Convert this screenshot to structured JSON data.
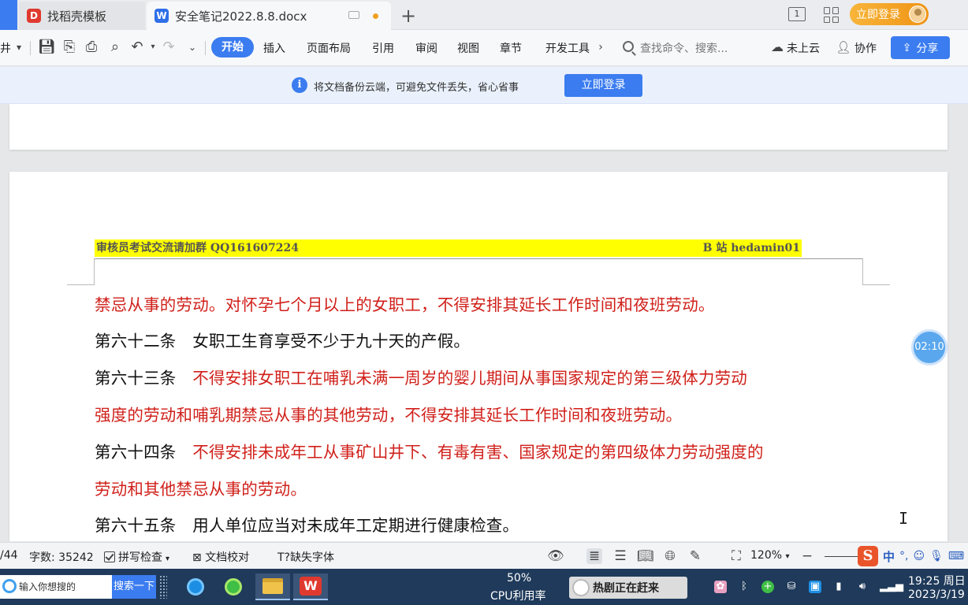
{
  "tabs": [
    {
      "label": "找稻壳模板",
      "icon": "docer-icon"
    },
    {
      "label": "安全笔记2022.8.8.docx",
      "icon": "wps-writer-icon"
    }
  ],
  "titlebar": {
    "page_indicator": "1",
    "login_label": "立即登录"
  },
  "toolbar": {
    "left_stub": "井",
    "ribbon_tabs": [
      "开始",
      "插入",
      "页面布局",
      "引用",
      "审阅",
      "视图",
      "章节",
      "开发工具"
    ],
    "search_placeholder": "查找命令、搜索...",
    "cloud_label": "未上云",
    "collab_label": "协作",
    "share_label": "分享"
  },
  "notice": {
    "text": "将文档备份云端，可避免文件丢失，省心省事",
    "button": "立即登录"
  },
  "document": {
    "header_left": "审核员考试交流请加群 QQ161607224",
    "header_right": "B 站 hedamin01",
    "lines": [
      {
        "segments": [
          {
            "text": "禁忌从事的劳动。对怀孕七个月以上的女职工，不得安排其延长工作时间和夜班劳动。",
            "color": "red"
          }
        ]
      },
      {
        "segments": [
          {
            "text": "第六十二条　女职工生育享受不少于九十天的产假。",
            "color": "black"
          }
        ]
      },
      {
        "segments": [
          {
            "text": "第六十三条　",
            "color": "black"
          },
          {
            "text": "不得安排女职工在哺乳未满一周岁的婴儿期间从事国家规定的第三级体力劳动",
            "color": "red"
          }
        ]
      },
      {
        "segments": [
          {
            "text": "强度的劳动和哺乳期禁忌从事的其他劳动，不得安排其延长工作时间和夜班劳动。",
            "color": "red"
          }
        ]
      },
      {
        "segments": [
          {
            "text": "第六十四条　",
            "color": "black"
          },
          {
            "text": "不得安排未成年工从事矿山井下、有毒有害、国家规定的第四级体力劳动强度的",
            "color": "red"
          }
        ]
      },
      {
        "segments": [
          {
            "text": "劳动和其他禁忌从事的劳动。",
            "color": "red"
          }
        ]
      },
      {
        "segments": [
          {
            "text": "第六十五条　用人单位应当对未成年工定期进行健康检查。",
            "color": "black"
          }
        ]
      }
    ],
    "timer": "02:10"
  },
  "statusbar": {
    "page": "/44",
    "word_count": "字数: 35242",
    "spell_check": "拼写检查",
    "doc_check": "文档校对",
    "missing_fonts": "缺失字体",
    "zoom": "120%"
  },
  "taskbar": {
    "search_placeholder": "输入你想搜的",
    "search_button": "搜索一下",
    "cpu_value": "50%",
    "cpu_label": "CPU利用率",
    "promo": "热剧正在赶来",
    "time": "19:25 周日",
    "date": "2023/3/19"
  },
  "colors": {
    "accent": "#3b7cf0",
    "doc_red": "#d0201a",
    "header_highlight": "#ffff00",
    "login_orange": "#f09314"
  }
}
